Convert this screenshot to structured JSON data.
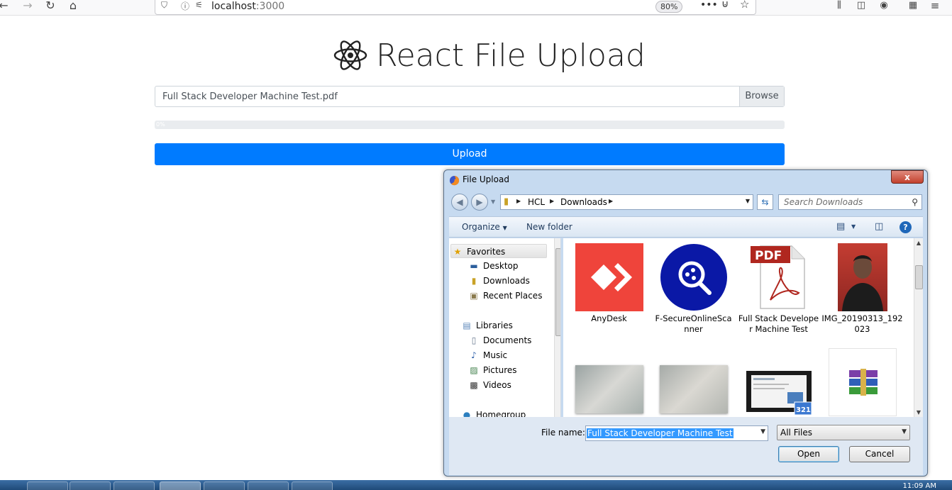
{
  "browser": {
    "url_host": "localhost",
    "url_port": ":3000",
    "zoom": "80%"
  },
  "app": {
    "title": "React File Upload",
    "file_name": "Full Stack Developer Machine Test.pdf",
    "browse_label": "Browse",
    "progress": "0%",
    "progress_value": 0,
    "upload_label": "Upload"
  },
  "dialog": {
    "title": "File Upload",
    "close_label": "x",
    "breadcrumbs": [
      "HCL",
      "Downloads"
    ],
    "search_placeholder": "Search Downloads",
    "organize_label": "Organize",
    "new_folder_label": "New folder",
    "help_label": "?",
    "nav": {
      "favorites": "Favorites",
      "desktop": "Desktop",
      "downloads": "Downloads",
      "recent_places": "Recent Places",
      "libraries": "Libraries",
      "documents": "Documents",
      "music": "Music",
      "pictures": "Pictures",
      "videos": "Videos",
      "homegroup": "Homegroup"
    },
    "files": [
      {
        "label": "AnyDesk",
        "icon": "anydesk-icon"
      },
      {
        "label": "F-SecureOnlineScanner",
        "icon": "fsecure-scanner-icon"
      },
      {
        "label": "Full Stack Developer Machine Test",
        "icon": "pdf-file-icon"
      },
      {
        "label": "IMG_20190313_192023",
        "icon": "photo-thumbnail"
      },
      {
        "label": "",
        "icon": "document-photo-thumbnail"
      },
      {
        "label": "",
        "icon": "document-photo-thumbnail"
      },
      {
        "label": "",
        "icon": "video-file-icon"
      },
      {
        "label": "",
        "icon": "winrar-archive-icon"
      }
    ],
    "file_name_label": "File name:",
    "file_name_value": "Full Stack Developer Machine Test",
    "file_type_value": "All Files",
    "open_label": "Open",
    "cancel_label": "Cancel"
  },
  "taskbar": {
    "clock": "11:09 AM"
  },
  "colors": {
    "primary": "#007bff",
    "anydesk": "#ef443b",
    "fsecure": "#0a18a6",
    "pdf": "#b0271f",
    "selection": "#3399ff"
  }
}
